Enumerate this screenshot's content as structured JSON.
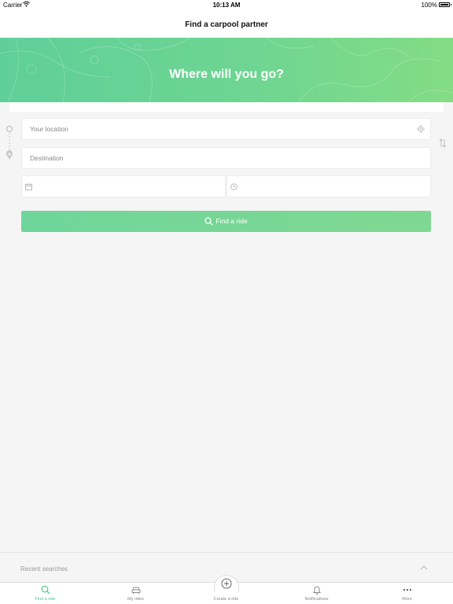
{
  "status_bar": {
    "carrier": "Carrier",
    "time": "10:13 AM",
    "battery": "100%"
  },
  "header": {
    "title": "Find a carpool partner"
  },
  "hero": {
    "title": "Where will you go?"
  },
  "form": {
    "location_placeholder": "Your location",
    "destination_placeholder": "Destination",
    "date_value": "",
    "time_value": "",
    "submit_label": "Find a ride"
  },
  "recent": {
    "label": "Recent searches"
  },
  "tabs": [
    {
      "label": "Find a ride",
      "icon": "search-icon",
      "active": true
    },
    {
      "label": "My rides",
      "icon": "car-icon",
      "active": false
    },
    {
      "label": "Create a ride",
      "icon": "plus-circle-icon",
      "active": false
    },
    {
      "label": "Notifications",
      "icon": "bell-icon",
      "active": false
    },
    {
      "label": "More",
      "icon": "more-icon",
      "active": false
    }
  ],
  "colors": {
    "accent": "#4fc792",
    "hero_start": "#5fcf99",
    "hero_end": "#84dc85"
  }
}
